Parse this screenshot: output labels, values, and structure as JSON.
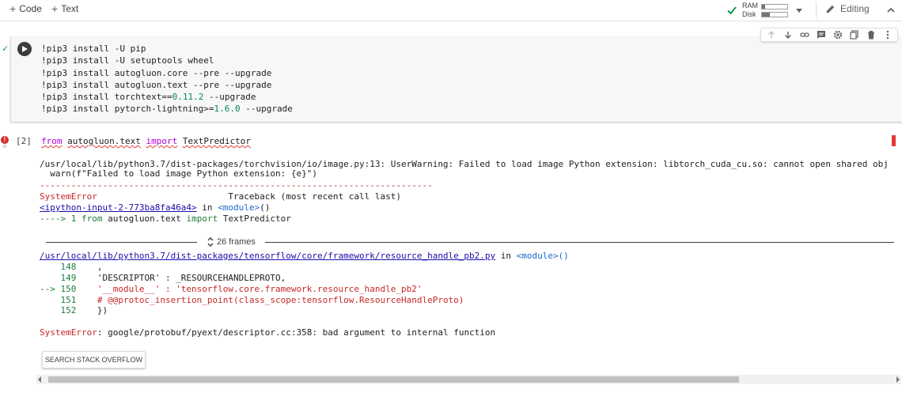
{
  "toolbar": {
    "add_code": "Code",
    "add_text": "Text",
    "ram_label": "RAM",
    "disk_label": "Disk",
    "ram_usage": 0.12,
    "disk_usage": 0.3,
    "editing_label": "Editing"
  },
  "cell1": {
    "lines": [
      "!pip3 install -U pip",
      "!pip3 install -U setuptools wheel",
      "!pip3 install autogluon.core --pre --upgrade",
      "!pip3 install autogluon.text --pre --upgrade"
    ],
    "line5_pre": "!pip3 install torchtext==",
    "line5_num": "0.11.2",
    "line5_post": " --upgrade",
    "line6_pre": "!pip3 install pytorch-lightning>=",
    "line6_num": "1.6.0",
    "line6_post": " --upgrade"
  },
  "cell2": {
    "exec_count": "[2]",
    "code_from": "from",
    "code_module": "autogluon.text",
    "code_import": "import",
    "code_name": "TextPredictor",
    "err_subscript": "35"
  },
  "output": {
    "warning1": "/usr/local/lib/python3.7/dist-packages/torchvision/io/image.py:13: UserWarning: Failed to load image Python extension: libtorch_cuda_cu.so: cannot open shared obj",
    "warning2": "  warn(f\"Failed to load image Python extension: {e}\")",
    "dashes": "---------------------------------------------------------------------------",
    "err_type": "SystemError",
    "traceback_hdr": "                         Traceback (most recent call last)",
    "input_link": "<ipython-input-2-773ba8fa46a4>",
    "in_word": " in ",
    "module_word": "<module>",
    "module_parens": "()",
    "arrow_line": "----> 1 ",
    "arrow_from": "from",
    "arrow_mid": " autogluon.text ",
    "arrow_import": "import",
    "arrow_end": " TextPredictor",
    "frames_label": "26 frames",
    "file_link": "/usr/local/lib/python3.7/dist-packages/tensorflow/core/framework/resource_handle_pb2.py",
    "l148_no": "    148",
    "l148_code": "    ,",
    "l149_no": "    149",
    "l149_code": "    'DESCRIPTOR' : _RESOURCEHANDLEPROTO,",
    "l150_no": "--> 150",
    "l150_code": "    '__module__' : 'tensorflow.core.framework.resource_handle_pb2'",
    "l151_no": "    151",
    "l151_code": "    # @@protoc_insertion_point(class_scope:tensorflow.ResourceHandleProto)",
    "l152_no": "    152",
    "l152_code": "    })",
    "final_type": "SystemError",
    "final_msg": ": google/protobuf/pyext/descriptor.cc:358: bad argument to internal function",
    "search_button": "SEARCH STACK OVERFLOW"
  },
  "colors": {
    "error_red": "#c62828",
    "link_blue": "#1a0dab",
    "number_green": "#098658"
  }
}
